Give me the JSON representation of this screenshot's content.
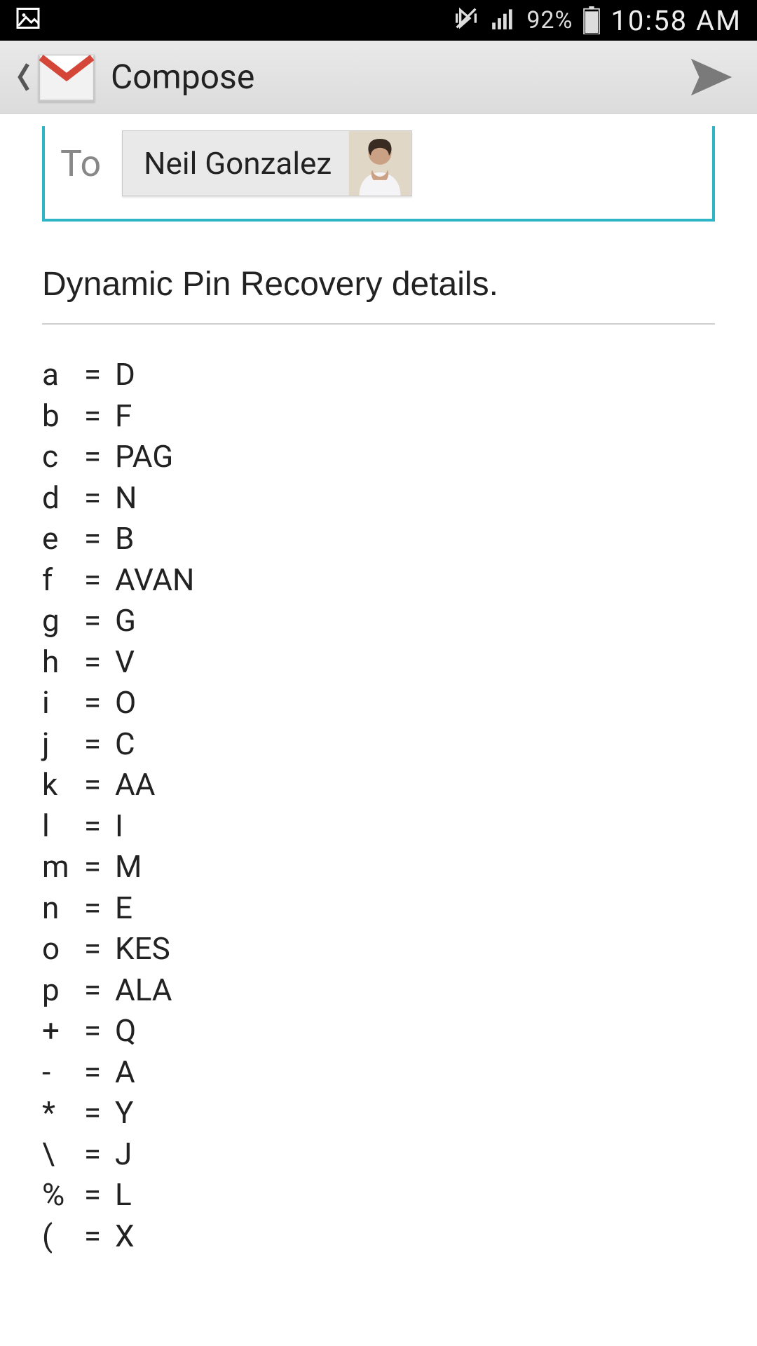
{
  "status": {
    "battery_pct": "92%",
    "time": "10:58 AM"
  },
  "header": {
    "title": "Compose"
  },
  "compose": {
    "to_label": "To",
    "recipient_name": "Neil Gonzalez",
    "subject": "Dynamic Pin Recovery details.",
    "body_lines": [
      {
        "k": "a",
        "v": "D"
      },
      {
        "k": "b",
        "v": "F"
      },
      {
        "k": "c",
        "v": "PAG"
      },
      {
        "k": "d",
        "v": "N"
      },
      {
        "k": "e",
        "v": "B"
      },
      {
        "k": "f",
        "v": "AVAN"
      },
      {
        "k": "g",
        "v": "G"
      },
      {
        "k": "h",
        "v": "V"
      },
      {
        "k": "i",
        "v": "O"
      },
      {
        "k": "j",
        "v": "C"
      },
      {
        "k": "k",
        "v": "AA"
      },
      {
        "k": "l",
        "v": "I"
      },
      {
        "k": "m",
        "v": "M"
      },
      {
        "k": "n",
        "v": "E"
      },
      {
        "k": "o",
        "v": "KES"
      },
      {
        "k": "p",
        "v": "ALA"
      },
      {
        "k": "+",
        "v": "Q"
      },
      {
        "k": "-",
        "v": "A"
      },
      {
        "k": "*",
        "v": "Y"
      },
      {
        "k": "\\",
        "v": "J"
      },
      {
        "k": "%",
        "v": "L"
      },
      {
        "k": "(",
        "v": "X"
      }
    ]
  }
}
